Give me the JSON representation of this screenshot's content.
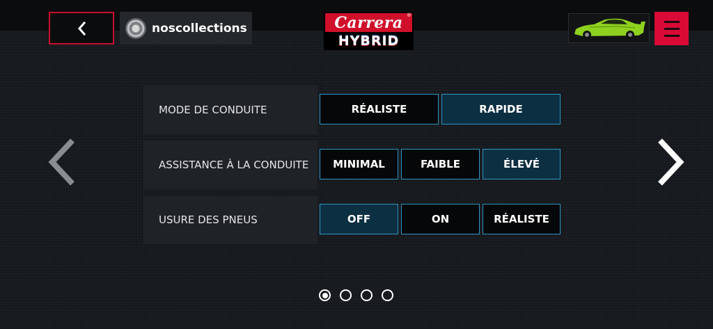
{
  "header": {
    "back_icon": "chevron-left-icon",
    "profile_icon": "wheel-rim-icon",
    "profile_name": "noscollections",
    "logo_top": "Carrera",
    "logo_bottom": "HYBRID",
    "logo_mark": "®",
    "car_icon": "green-sports-car-icon",
    "menu_icon": "hamburger-menu-icon",
    "brand_red": "#d90a35"
  },
  "settings": [
    {
      "label": "MODE DE CONDUITE",
      "options": [
        "RÉALISTE",
        "RAPIDE"
      ],
      "selected": "RAPIDE"
    },
    {
      "label": "ASSISTANCE À LA CONDUITE",
      "options": [
        "MINIMAL",
        "FAIBLE",
        "ÉLEVÉ"
      ],
      "selected": "ÉLEVÉ"
    },
    {
      "label": "USURE DES PNEUS",
      "options": [
        "OFF",
        "ON",
        "RÉALISTE"
      ],
      "selected": "OFF"
    }
  ],
  "pagination": {
    "pages": 4,
    "current": 1
  },
  "nav": {
    "prev_icon": "chevron-left-large-icon",
    "next_icon": "chevron-right-large-icon"
  },
  "colors": {
    "accent": "#2e96c4",
    "selected_bg": "#0c2f42"
  }
}
